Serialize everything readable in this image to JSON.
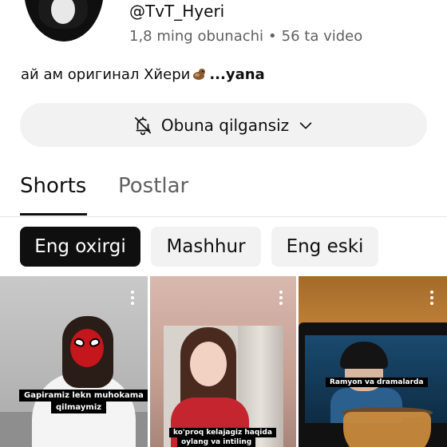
{
  "channel": {
    "handle": "@TvT_Hyeri",
    "subscribers": "1,8 ming obunachi",
    "separator": "•",
    "videos": "56 ta video",
    "description": "ай ам оригинал Хйери",
    "more_label": "...yana"
  },
  "subscribe_button": {
    "label": "Obuna qilgansiz",
    "icon": "bell-off-icon",
    "chevron": "chevron-down-icon"
  },
  "tabs": [
    {
      "label": "Shorts",
      "active": true
    },
    {
      "label": "Postlar",
      "active": false
    }
  ],
  "filters": [
    {
      "label": "Eng oxirgi",
      "active": true
    },
    {
      "label": "Mashhur",
      "active": false
    },
    {
      "label": "Eng eski",
      "active": false
    }
  ],
  "shorts": [
    {
      "caption_line1": "Gapiramiz lekn muhokama",
      "caption_line2": "qilmaymiz"
    },
    {
      "caption_line1": "ko'proq kelajagiz haqida",
      "caption_line2": "oylang va intiling"
    },
    {
      "caption_line1": "Ramyon va dramalarda"
    }
  ],
  "colors": {
    "text_primary": "#0f0f0f",
    "text_secondary": "#606060",
    "chip_bg": "#f2f2f2",
    "chip_active_bg": "#0f0f0f"
  }
}
